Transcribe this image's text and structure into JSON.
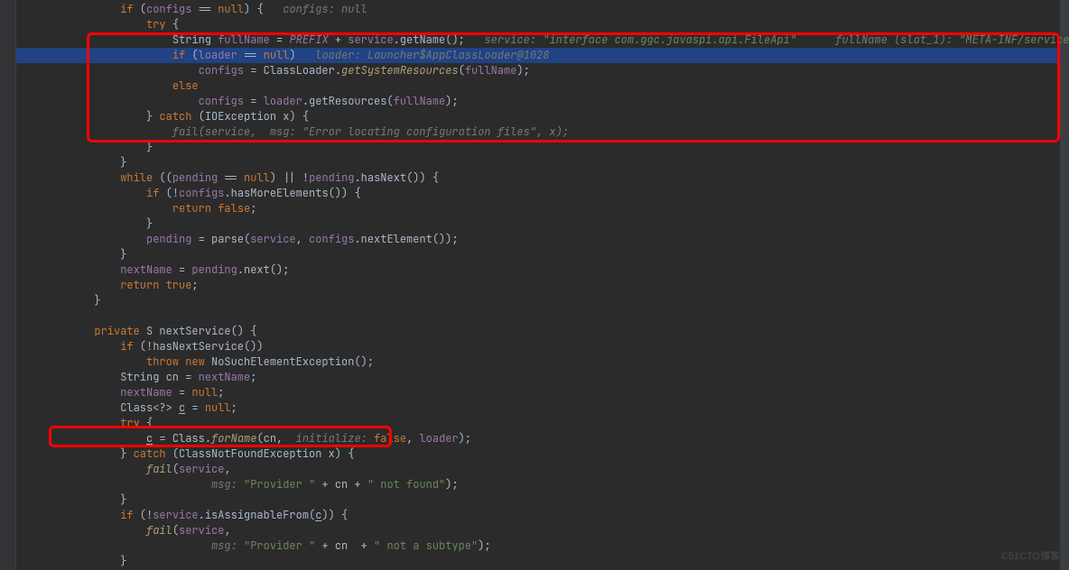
{
  "watermark": "©51CTO博客",
  "colors": {
    "keyword": "#cc7832",
    "string": "#6a8759",
    "hint": "#787878",
    "field": "#9876aa",
    "highlight": "#214283",
    "background": "#2b2b2b"
  },
  "highlight_boxes": {
    "box1": {
      "top_line": 2,
      "height_lines": 8
    },
    "box2": {
      "around_line": 28
    }
  },
  "lines": [
    {
      "ind": 4,
      "seg": [
        [
          "kw",
          "if"
        ],
        [
          "",
          " ("
        ],
        [
          "field",
          "configs"
        ],
        [
          "",
          " == "
        ],
        [
          "kw",
          "null"
        ],
        [
          "",
          ") {   "
        ],
        [
          "hint",
          "configs: "
        ],
        [
          "hint",
          "null"
        ]
      ]
    },
    {
      "ind": 5,
      "seg": [
        [
          "kw",
          "try"
        ],
        [
          "",
          " {"
        ]
      ]
    },
    {
      "ind": 6,
      "seg": [
        [
          "",
          "String "
        ],
        [
          "field",
          "fullName"
        ],
        [
          "",
          " = "
        ],
        [
          "const",
          "PREFIX"
        ],
        [
          "",
          " + "
        ],
        [
          "field",
          "service"
        ],
        [
          ""
        ],
        [
          "",
          ".getName();   "
        ],
        [
          "hint",
          "service: "
        ],
        [
          "str-ital",
          "\"interface com.ggc.javaspi.api.FileApi\""
        ],
        [
          "",
          "      "
        ],
        [
          "hint",
          "fullName (slot_1): "
        ],
        [
          "str-ital",
          "\"META-INF/services/com.ggc.javaspi.api.FileApi\""
        ]
      ]
    },
    {
      "ind": 6,
      "hl": true,
      "seg": [
        [
          "kw",
          "if"
        ],
        [
          "",
          " ("
        ],
        [
          "field",
          "loader"
        ],
        [
          "",
          " == "
        ],
        [
          "kw",
          "null"
        ],
        [
          "",
          ")   "
        ],
        [
          "hint",
          "loader: Launcher$AppClassLoader@1028"
        ]
      ]
    },
    {
      "ind": 7,
      "seg": [
        [
          "field",
          "configs"
        ],
        [
          "",
          " = ClassLoader."
        ],
        [
          "meth-i",
          "getSystemResources"
        ],
        [
          "",
          "("
        ],
        [
          "field",
          "fullName"
        ],
        [
          "",
          ");"
        ]
      ]
    },
    {
      "ind": 6,
      "seg": [
        [
          "kw",
          "else"
        ]
      ]
    },
    {
      "ind": 7,
      "seg": [
        [
          "field",
          "configs"
        ],
        [
          "",
          " = "
        ],
        [
          "field",
          "loader"
        ],
        [
          "",
          ".getResources("
        ],
        [
          "field",
          "fullName"
        ],
        [
          "",
          ");"
        ]
      ]
    },
    {
      "ind": 5,
      "seg": [
        [
          "",
          "} "
        ],
        [
          "kw",
          "catch"
        ],
        [
          "",
          " (IOException x) {"
        ]
      ]
    },
    {
      "ind": 6,
      "seg": [
        [
          "hint",
          "fail(service,  msg: \"Error locating configuration files\", x);"
        ]
      ]
    },
    {
      "ind": 5,
      "seg": [
        [
          "",
          "}"
        ]
      ]
    },
    {
      "ind": 4,
      "seg": [
        [
          "",
          "}"
        ]
      ]
    },
    {
      "ind": 4,
      "seg": [
        [
          "kw",
          "while"
        ],
        [
          "",
          " (("
        ],
        [
          "field",
          "pending"
        ],
        [
          "",
          " == "
        ],
        [
          "kw",
          "null"
        ],
        [
          "",
          ") || !"
        ],
        [
          "field",
          "pending"
        ],
        [
          "",
          ".hasNext()) {"
        ]
      ]
    },
    {
      "ind": 5,
      "seg": [
        [
          "kw",
          "if"
        ],
        [
          "",
          " (!"
        ],
        [
          "field",
          "configs"
        ],
        [
          "",
          ".hasMoreElements()) {"
        ]
      ]
    },
    {
      "ind": 6,
      "seg": [
        [
          "kw",
          "return false"
        ],
        [
          "",
          ";"
        ]
      ]
    },
    {
      "ind": 5,
      "seg": [
        [
          "",
          "}"
        ]
      ]
    },
    {
      "ind": 5,
      "seg": [
        [
          "field",
          "pending"
        ],
        [
          "",
          " = parse("
        ],
        [
          "field",
          "service"
        ],
        [
          "",
          ", "
        ],
        [
          "field",
          "configs"
        ],
        [
          "",
          ".nextElement());"
        ]
      ]
    },
    {
      "ind": 4,
      "seg": [
        [
          "",
          "}"
        ]
      ]
    },
    {
      "ind": 4,
      "seg": [
        [
          "field",
          "nextName"
        ],
        [
          "",
          " = "
        ],
        [
          "field",
          "pending"
        ],
        [
          "",
          ".next();"
        ]
      ]
    },
    {
      "ind": 4,
      "seg": [
        [
          "kw",
          "return true"
        ],
        [
          "",
          ";"
        ]
      ]
    },
    {
      "ind": 3,
      "seg": [
        [
          "",
          "}"
        ]
      ]
    },
    {
      "ind": 0,
      "seg": [
        [
          "",
          ""
        ]
      ]
    },
    {
      "ind": 3,
      "seg": [
        [
          "kw",
          "private"
        ],
        [
          "",
          " "
        ],
        [
          "type",
          "S"
        ],
        [
          "",
          " nextService() {"
        ]
      ]
    },
    {
      "ind": 4,
      "seg": [
        [
          "kw",
          "if"
        ],
        [
          "",
          " (!hasNextService())"
        ]
      ]
    },
    {
      "ind": 5,
      "seg": [
        [
          "kw",
          "throw new"
        ],
        [
          "",
          " NoSuchElementException();"
        ]
      ]
    },
    {
      "ind": 4,
      "seg": [
        [
          "",
          "String cn = "
        ],
        [
          "field",
          "nextName"
        ],
        [
          "",
          ";"
        ]
      ]
    },
    {
      "ind": 4,
      "seg": [
        [
          "field",
          "nextName"
        ],
        [
          "",
          " = "
        ],
        [
          "kw",
          "null"
        ],
        [
          "",
          ";"
        ]
      ]
    },
    {
      "ind": 4,
      "seg": [
        [
          "",
          "Class<?> "
        ],
        [
          "under",
          "c"
        ],
        [
          "",
          " = "
        ],
        [
          "kw",
          "null"
        ],
        [
          "",
          ";"
        ]
      ]
    },
    {
      "ind": 4,
      "seg": [
        [
          "kw",
          "try"
        ],
        [
          "",
          " {"
        ]
      ]
    },
    {
      "ind": 5,
      "seg": [
        [
          "under",
          "c"
        ],
        [
          "",
          " = Class."
        ],
        [
          "meth-i",
          "forName"
        ],
        [
          "",
          "(cn,  "
        ],
        [
          "hint",
          "initialize: "
        ],
        [
          "kw",
          "false"
        ],
        [
          "",
          ", "
        ],
        [
          "field",
          "loader"
        ],
        [
          "",
          ");"
        ]
      ]
    },
    {
      "ind": 4,
      "seg": [
        [
          "",
          "} "
        ],
        [
          "kw",
          "catch"
        ],
        [
          "",
          " (ClassNotFoundException x) {"
        ]
      ]
    },
    {
      "ind": 5,
      "seg": [
        [
          "meth-i",
          "fail"
        ],
        [
          "",
          "("
        ],
        [
          "field",
          "service"
        ],
        [
          "",
          ","
        ]
      ]
    },
    {
      "ind": 7,
      "seg": [
        [
          "",
          "  "
        ],
        [
          "hint",
          "msg: "
        ],
        [
          "str",
          "\"Provider \""
        ],
        [
          "",
          " + cn + "
        ],
        [
          "str",
          "\" not found\""
        ],
        [
          "",
          ");"
        ]
      ]
    },
    {
      "ind": 4,
      "seg": [
        [
          "",
          "}"
        ]
      ]
    },
    {
      "ind": 4,
      "seg": [
        [
          "kw",
          "if"
        ],
        [
          "",
          " (!"
        ],
        [
          "field",
          "service"
        ],
        [
          "",
          ".isAssignableFrom("
        ],
        [
          "under",
          "c"
        ],
        [
          "",
          ")) {"
        ]
      ]
    },
    {
      "ind": 5,
      "seg": [
        [
          "meth-i",
          "fail"
        ],
        [
          "",
          "("
        ],
        [
          "field",
          "service"
        ],
        [
          "",
          ","
        ]
      ]
    },
    {
      "ind": 7,
      "seg": [
        [
          "",
          "  "
        ],
        [
          "hint",
          "msg: "
        ],
        [
          "str",
          "\"Provider \""
        ],
        [
          "",
          " + cn  + "
        ],
        [
          "str",
          "\" not a subtype\""
        ],
        [
          "",
          ");"
        ]
      ]
    },
    {
      "ind": 4,
      "seg": [
        [
          "",
          "}"
        ]
      ]
    }
  ]
}
